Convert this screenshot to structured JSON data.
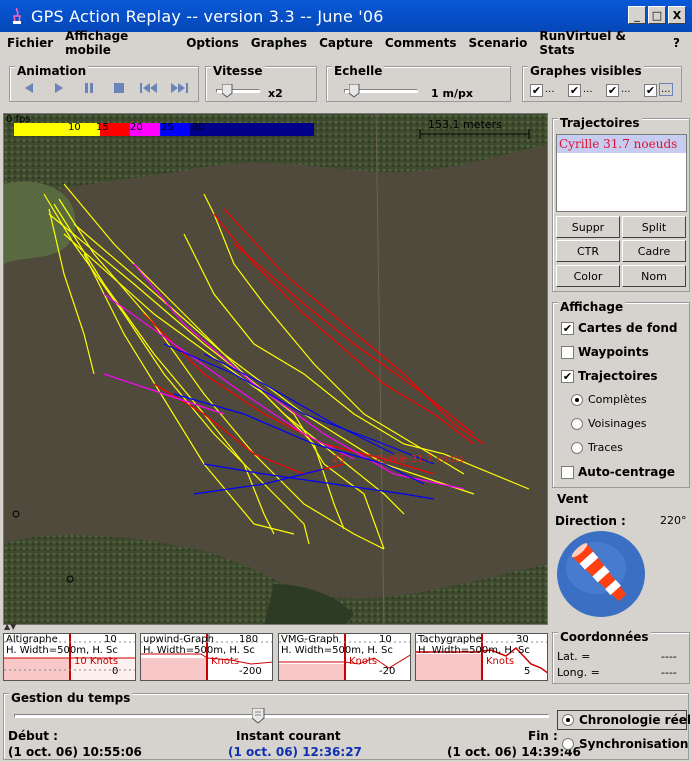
{
  "window": {
    "title": "GPS Action Replay -- version 3.3 -- June '06",
    "minimize": "_",
    "maximize": "□",
    "close": "X"
  },
  "menu": [
    "Fichier",
    "Affichage mobile",
    "Options",
    "Graphes",
    "Capture",
    "Comments",
    "Scenario",
    "RunVirtuel & Stats",
    "?"
  ],
  "toolbar": {
    "animation_label": "Animation",
    "vitesse_label": "Vitesse",
    "vitesse_value": "x2",
    "echelle_label": "Echelle",
    "echelle_value": "1 m/px",
    "graphes_label": "Graphes visibles",
    "graphes_checks": [
      "...",
      "...",
      "...",
      "..."
    ]
  },
  "map": {
    "legend_start": "0 fps",
    "legend_labels": [
      "10",
      "15",
      "20",
      "25",
      "30"
    ],
    "legend_colors": [
      "#ffff00",
      "#ff0000",
      "#ff00ff",
      "#0000ff",
      "#00008b"
    ],
    "scale_text": "153,1 meters",
    "track_label": "Cyrille 31.7 knots",
    "track_speed_label": "25"
  },
  "trajectoires": {
    "title": "Trajectoires",
    "items": [
      "Cyrille 31.7 noeuds"
    ],
    "buttons": [
      "Suppr",
      "Split",
      "CTR",
      "Cadre",
      "Color",
      "Nom"
    ]
  },
  "affichage": {
    "title": "Affichage",
    "cartes": "Cartes de fond",
    "waypoints": "Waypoints",
    "trajectoires": "Trajectoires",
    "completes": "Complètes",
    "voisinages": "Voisinages",
    "traces": "Traces",
    "autocentrage": "Auto-centrage"
  },
  "vent": {
    "title": "Vent",
    "direction_label": "Direction :",
    "direction_value": "220°"
  },
  "graphs": [
    {
      "title": "Altigraphe",
      "line2": "H. Width=500m, H. Sc",
      "line3": "10 Knots",
      "val1": "10",
      "val2": "0"
    },
    {
      "title": "upwind-Graph",
      "line2": "H. Width=500m, H. Sc",
      "line3": "Knots",
      "val1": "180",
      "val2": "-200"
    },
    {
      "title": "VMG-Graph",
      "line2": "H. Width=500m, H. Sc",
      "line3": "Knots",
      "val1": "10",
      "val2": "-20"
    },
    {
      "title": "Tachygraphe",
      "line2": "H. Width=500m, H. Sc",
      "line3": "Knots",
      "val1": "30",
      "val2": "5"
    }
  ],
  "coordonnees": {
    "title": "Coordonnées",
    "lat_label": "Lat. =",
    "lat_value": "----",
    "long_label": "Long. =",
    "long_value": "----"
  },
  "temps": {
    "title": "Gestion du temps",
    "debut_label": "Début :",
    "debut_value": "(1 oct. 06) 10:55:06",
    "instant_label": "Instant courant",
    "instant_value": "(1 oct. 06) 12:36:27",
    "fin_label": "Fin :",
    "fin_value": "(1 oct. 06) 14:39:46",
    "chrono": "Chronologie réelle",
    "synchro": "Synchronisation"
  }
}
